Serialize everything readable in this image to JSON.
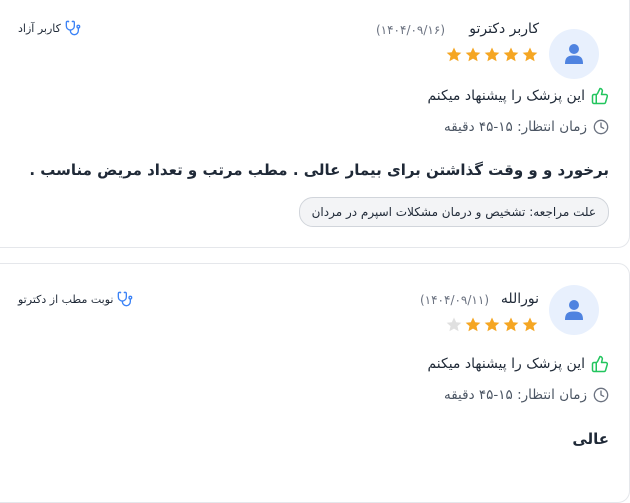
{
  "reviews": [
    {
      "name": "کاربر دکترتو",
      "date": "(۱۴۰۴/۰۹/۱۶)",
      "rating": 5,
      "recommend": "این پزشک را پیشنهاد میکنم",
      "wait_time": "زمان انتظار: ۱۵-۴۵ دقیقه",
      "comment": "برخورد و و وقت گذاشتن برای بیمار عالی . مطب مرتب و تعداد مریض مناسب .",
      "reason": "علت مراجعه: تشخیص و درمان مشکلات اسپرم در مردان",
      "badge": "کاربر آزاد"
    },
    {
      "name": "نورالله",
      "date": "(۱۴۰۴/۰۹/۱۱)",
      "rating": 4,
      "recommend": "این پزشک را پیشنهاد میکنم",
      "wait_time": "زمان انتظار: ۱۵-۴۵ دقیقه",
      "comment": "عالی",
      "badge": "نوبت مطب از دکترتو"
    }
  ],
  "colors": {
    "star_filled": "#f5a623",
    "star_empty": "#e0e0e0",
    "thumb_green": "#22c55e",
    "avatar_bg": "#e8f0fd",
    "avatar_icon": "#4f83e0",
    "badge_icon": "#3b82f6"
  },
  "icons": {
    "avatar": "user-icon",
    "recommend": "thumbs-up-icon",
    "wait": "clock-icon",
    "badge": "stethoscope-icon"
  }
}
